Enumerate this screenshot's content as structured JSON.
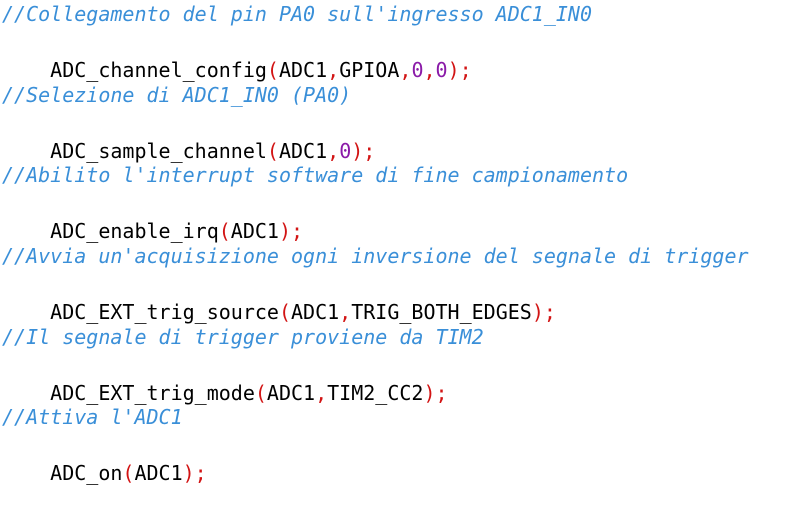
{
  "colors": {
    "background": "#ffffff",
    "comment": "#3a8fd8",
    "identifier": "#000000",
    "punctuation": "#d21414",
    "number": "#8a1aa8"
  },
  "code_block": {
    "sections": [
      {
        "comment": "//Collegamento del pin PA0 sull'ingresso ADC1_IN0",
        "code": {
          "function": "ADC_channel_config",
          "open_paren": "(",
          "args": [
            {
              "text": "ADC1",
              "kind": "identifier"
            },
            {
              "text": "GPIOA",
              "kind": "identifier"
            },
            {
              "text": "0",
              "kind": "number"
            },
            {
              "text": "0",
              "kind": "number"
            }
          ],
          "close": ");"
        }
      },
      {
        "comment": "//Selezione di ADC1_IN0 (PA0)",
        "code": {
          "function": "ADC_sample_channel",
          "open_paren": "(",
          "args": [
            {
              "text": "ADC1",
              "kind": "identifier"
            },
            {
              "text": "0",
              "kind": "number"
            }
          ],
          "close": ");"
        }
      },
      {
        "comment": "//Abilito l'interrupt software di fine campionamento",
        "code": {
          "function": "ADC_enable_irq",
          "open_paren": "(",
          "args": [
            {
              "text": "ADC1",
              "kind": "identifier"
            }
          ],
          "close": ");"
        }
      },
      {
        "comment": "//Avvia un'acquisizione ogni inversione del segnale di trigger",
        "code": {
          "function": "ADC_EXT_trig_source",
          "open_paren": "(",
          "args": [
            {
              "text": "ADC1",
              "kind": "identifier"
            },
            {
              "text": "TRIG_BOTH_EDGES",
              "kind": "identifier"
            }
          ],
          "close": ");"
        }
      },
      {
        "comment": "//Il segnale di trigger proviene da TIM2",
        "code": {
          "function": "ADC_EXT_trig_mode",
          "open_paren": "(",
          "args": [
            {
              "text": "ADC1",
              "kind": "identifier"
            },
            {
              "text": "TIM2_CC2",
              "kind": "identifier"
            }
          ],
          "close": ");"
        }
      },
      {
        "comment": "//Attiva l'ADC1",
        "code": {
          "function": "ADC_on",
          "open_paren": "(",
          "args": [
            {
              "text": "ADC1",
              "kind": "identifier"
            }
          ],
          "close": ");"
        }
      }
    ],
    "arg_separator": ","
  }
}
